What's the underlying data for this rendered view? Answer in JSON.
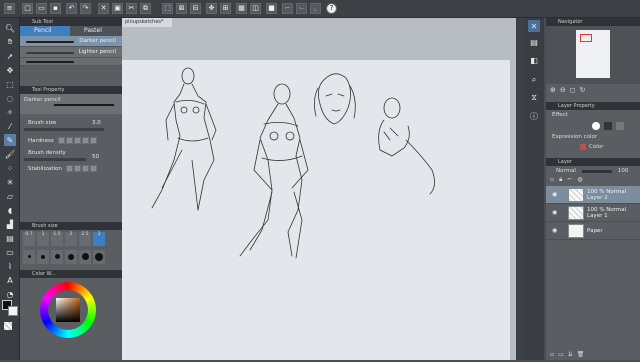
{
  "toolbar": {
    "help": "?"
  },
  "sub_tool": {
    "title": "Sub Tool",
    "tabs": [
      "Pencil",
      "Pastel"
    ],
    "brushes": [
      "Darker pencil",
      "Lighter pencil"
    ]
  },
  "tool_property": {
    "title": "Tool Property",
    "current": "Darker pencil",
    "brush_size_label": "Brush size",
    "brush_size_value": "3.0",
    "hardness_label": "Hardness",
    "brush_density_label": "Brush density",
    "brush_density_value": "50",
    "stabilization_label": "Stabilization"
  },
  "brush_size_panel": {
    "title": "Brush size",
    "sizes": [
      "0.7",
      "1",
      "1.5",
      "2",
      "2.5",
      "3"
    ]
  },
  "color_wheel": {
    "title": "Color W..."
  },
  "document": {
    "tab": "pinupsketches*"
  },
  "navigator": {
    "title": "Navigator"
  },
  "layer_property": {
    "title": "Layer Property",
    "effect": "Effect",
    "expression_color": "Expression color",
    "color": "Color"
  },
  "layer_panel": {
    "title": "Layer",
    "blend": "Normal",
    "opacity": "100",
    "layers": [
      {
        "opacity": "100 %",
        "mode": "Normal",
        "name": "Layer 2"
      },
      {
        "opacity": "100 %",
        "mode": "Normal",
        "name": "Layer 1"
      },
      {
        "opacity": "",
        "mode": "",
        "name": "Paper"
      }
    ]
  },
  "colors": {
    "accent": "#3f7fbf",
    "canvas": "#e3e6eb",
    "panel": "#5a5e63"
  }
}
